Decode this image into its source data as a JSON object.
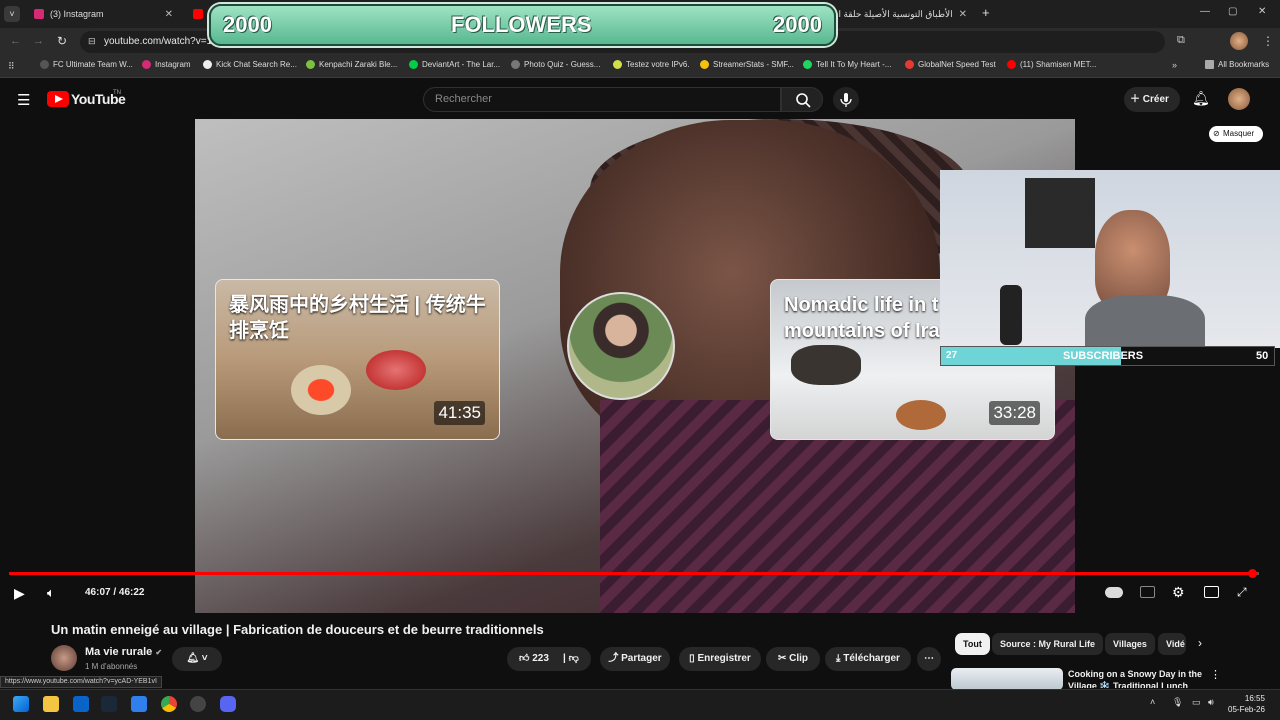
{
  "browser": {
    "tabs": [
      {
        "label": "(3) Instagram",
        "favicon": "instagram-icon",
        "color": "#d62976"
      },
      {
        "label": "20",
        "favicon": "youtube-icon",
        "color": "#ff0000"
      },
      {
        "label": "الأطباق التونسية الأصيلة حلقة ا...",
        "favicon": "page-icon",
        "color": "#888888"
      }
    ],
    "new_tab": "+",
    "url": "youtube.com/watch?v=1N5",
    "bookmarks": [
      "FC Ultimate Team W...",
      "Instagram",
      "Kick Chat Search Re...",
      "Kenpachi Zaraki Ble...",
      "DeviantArt - The Lar...",
      "Photo Quiz - Guess...",
      "Testez votre IPv6.",
      "StreamerStats - SMF...",
      "Tell It To My Heart -...",
      "GlobalNet Speed Test",
      "(11) Shamisen MET..."
    ],
    "all_bookmarks": "All Bookmarks",
    "status_url": "https://www.youtube.com/watch?v=ycAD-YEB1vI"
  },
  "overlay": {
    "followers_left": "2000",
    "followers_label": "FOLLOWERS",
    "followers_right": "2000",
    "subs_current": "27",
    "subs_label": "SUBSCRIBERS",
    "subs_goal": "50",
    "subs_fraction": 0.54
  },
  "youtube": {
    "logo_text": "YouTube",
    "logo_region": "TN",
    "search_placeholder": "Rechercher",
    "create_label": "Créer",
    "masquer_label": "Masquer",
    "endcards": [
      {
        "title": "暴风雨中的乡村生活 | 传统牛排烹饪",
        "duration": "41:35"
      },
      {
        "title": "Nomadic life in t mountains of Ira",
        "duration": "33:28"
      }
    ],
    "player": {
      "time": "46:07 / 46:22",
      "progress": 0.994
    },
    "video_title": "Un matin enneigé au village | Fabrication de douceurs et de beurre traditionnels",
    "channel_name": "Ma vie rurale",
    "subscribers": "1 M d'abonnés",
    "likes": "223",
    "share_label": "Partager",
    "save_label": "Enregistrer",
    "clip_label": "Clip",
    "download_label": "Télécharger",
    "chips": [
      "Tout",
      "Source : My Rural Life",
      "Villages",
      "Vidé"
    ],
    "recommended_title": "Cooking on a Snowy Day in the Village ❄️ Traditional Lunch"
  },
  "taskbar": {
    "time": "16:55",
    "date": "05-Feb-26"
  },
  "colors": {
    "accent_red": "#ff0000",
    "banner_green": "#58b88f",
    "subs_cyan": "#6fd4d6"
  }
}
